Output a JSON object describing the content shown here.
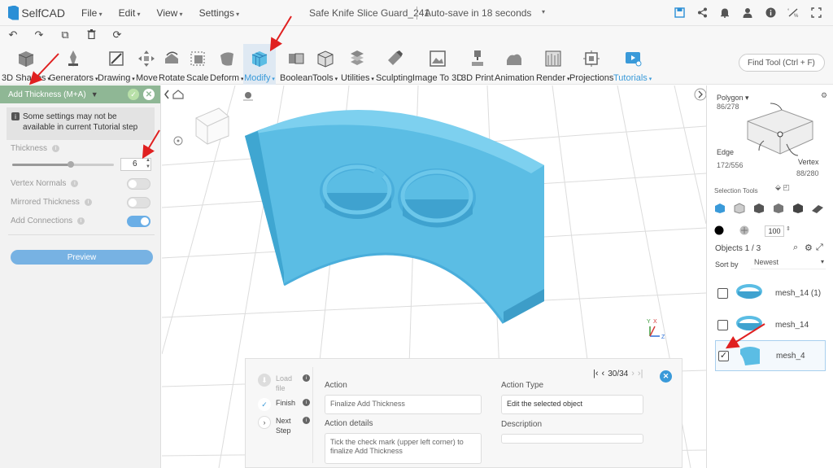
{
  "app": {
    "name": "SelfCAD",
    "menus": [
      "File",
      "Edit",
      "View",
      "Settings"
    ],
    "doc_title": "Safe Knife Slice Guard_241",
    "autosave": "Auto-save in 18 seconds"
  },
  "toolbar": {
    "tools": [
      {
        "label": "3D Shapes",
        "icon": "cube-icon",
        "caret": true
      },
      {
        "label": "Generators",
        "icon": "generators-icon",
        "caret": true
      },
      {
        "label": "Drawing",
        "icon": "drawing-icon",
        "caret": true
      },
      {
        "label": "Move",
        "icon": "move-icon",
        "caret": false
      },
      {
        "label": "Rotate",
        "icon": "rotate-icon",
        "caret": false
      },
      {
        "label": "Scale",
        "icon": "scale-icon",
        "caret": false
      },
      {
        "label": "Deform",
        "icon": "deform-icon",
        "caret": true
      },
      {
        "label": "Modify",
        "icon": "modify-icon",
        "caret": true
      },
      {
        "label": "Boolean",
        "icon": "boolean-icon",
        "caret": false
      },
      {
        "label": "Tools",
        "icon": "tools-icon",
        "caret": true
      },
      {
        "label": "Utilities",
        "icon": "utilities-icon",
        "caret": true
      },
      {
        "label": "Sculpting",
        "icon": "sculpting-icon",
        "caret": false
      },
      {
        "label": "Image To 3D",
        "icon": "image-to-3d-icon",
        "caret": false
      },
      {
        "label": "3D Print",
        "icon": "3d-print-icon",
        "caret": false
      },
      {
        "label": "Animation",
        "icon": "animation-icon",
        "caret": false
      },
      {
        "label": "Render",
        "icon": "render-icon",
        "caret": true
      },
      {
        "label": "Projections",
        "icon": "projections-icon",
        "caret": false
      },
      {
        "label": "Tutorials",
        "icon": "tutorials-icon",
        "caret": true
      }
    ],
    "find_tool": "Find Tool (Ctrl + F)"
  },
  "left_panel": {
    "title": "Add Thickness (M+A)",
    "notice": "Some settings may not be available in current Tutorial step",
    "thickness_label": "Thickness",
    "thickness_value": "6",
    "thickness_slider_fraction": 0.56,
    "vertex_normals_label": "Vertex Normals",
    "vertex_normals_on": false,
    "mirrored_label": "Mirrored Thickness",
    "mirrored_on": false,
    "connections_label": "Add Connections",
    "connections_on": true,
    "preview_label": "Preview"
  },
  "right_panel": {
    "polygon_label": "Polygon",
    "polygon_count": "86/278",
    "edge_label": "Edge",
    "edge_count": "172/556",
    "vertex_label": "Vertex",
    "vertex_count": "88/280",
    "selection_tools_label": "Selection Tools",
    "opacity_value": "100",
    "objects_label": "Objects 1 / 3",
    "sort_label": "Sort by",
    "sort_value": "Newest",
    "objects": [
      {
        "name": "mesh_14 (1)",
        "checked": false,
        "selected": false
      },
      {
        "name": "mesh_14",
        "checked": false,
        "selected": false
      },
      {
        "name": "mesh_4",
        "checked": true,
        "selected": true
      }
    ]
  },
  "viewport": {
    "axis_labels": [
      "Y",
      "X",
      "Z"
    ],
    "mesh_color": "#5bbde4"
  },
  "tutorial": {
    "steps": [
      {
        "label": "Load file",
        "state": "pending"
      },
      {
        "label": "Finish",
        "state": "done"
      },
      {
        "label": "Next Step",
        "state": "next"
      }
    ],
    "action_label": "Action",
    "action_value": "Finalize Add Thickness",
    "action_details_label": "Action details",
    "action_details_value": "Tick the check mark (upper left corner) to finalize Add Thickness",
    "action_type_label": "Action Type",
    "action_type_value": "Edit the selected object",
    "description_label": "Description",
    "description_value": "",
    "pager": "30/34"
  },
  "colors": {
    "accent": "#3a9ad9",
    "panel_header": "#8fb795",
    "arrow": "#e02020"
  }
}
